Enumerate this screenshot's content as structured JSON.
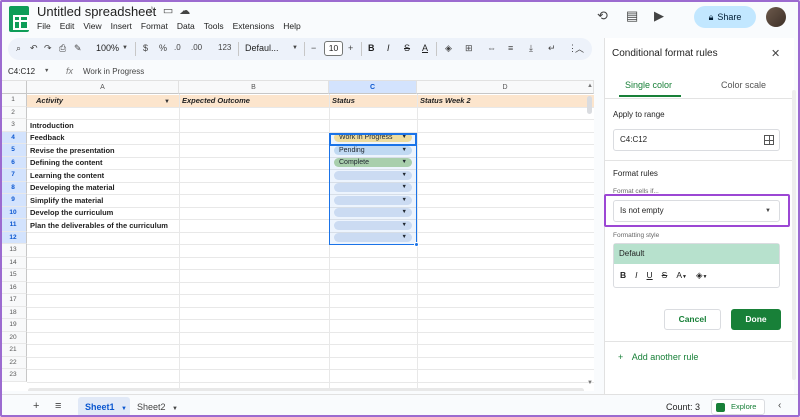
{
  "app": {
    "doc_title": "Untitled spreadsheet",
    "menu": [
      "File",
      "Edit",
      "View",
      "Insert",
      "Format",
      "Data",
      "Tools",
      "Extensions",
      "Help"
    ],
    "share_label": "Share"
  },
  "toolbar": {
    "zoom": "100%",
    "currency": "$",
    "percent": "%",
    "decrease_decimal": ".0",
    "increase_decimal": ".00",
    "number_format": "123",
    "font": "Defaul...",
    "font_size": "10",
    "bold": "B",
    "italic": "I",
    "strike": "S",
    "text_color": "A"
  },
  "formula_bar": {
    "name_box": "C4:C12",
    "fx": "fx",
    "value": "Work in Progress"
  },
  "grid": {
    "columns": [
      "A",
      "B",
      "C",
      "D"
    ],
    "rows": [
      "1",
      "2",
      "3",
      "4",
      "5",
      "6",
      "7",
      "8",
      "9",
      "10",
      "11",
      "12",
      "13",
      "14",
      "15",
      "16",
      "17",
      "18",
      "19",
      "20",
      "21",
      "22",
      "23"
    ],
    "header_row": {
      "a": "Activity",
      "b": "Expected Outcome",
      "c": "Status",
      "d": "Status Week 2"
    },
    "col_a": {
      "r3": "Introduction",
      "r4": "Feedback",
      "r5": "Revise the presentation",
      "r6": "Defining the content",
      "r7": "Learning the content",
      "r8": "Developing the material",
      "r9": "Simplify the material",
      "r10": "Develop the curriculum",
      "r11": "Plan the deliverables of the curriculum"
    },
    "status_chips": [
      {
        "text": "Work in Progress",
        "color": "#ffe599"
      },
      {
        "text": "Pending",
        "color": "#cfe2f3"
      },
      {
        "text": "Complete",
        "color": "#b6d7a8"
      },
      {
        "text": "",
        "color": "#dbe4f3"
      },
      {
        "text": "",
        "color": "#dbe4f3"
      },
      {
        "text": "",
        "color": "#dbe4f3"
      },
      {
        "text": "",
        "color": "#dbe4f3"
      },
      {
        "text": "",
        "color": "#dbe4f3"
      },
      {
        "text": "",
        "color": "#dbe4f3"
      }
    ]
  },
  "sheets": {
    "active": "Sheet1",
    "other": "Sheet2",
    "count": "Count: 3",
    "explore": "Explore"
  },
  "panel": {
    "title": "Conditional format rules",
    "tab_single": "Single color",
    "tab_scale": "Color scale",
    "apply_label": "Apply to range",
    "range": "C4:C12",
    "rules_label": "Format rules",
    "cells_if_label": "Format cells if...",
    "condition": "Is not empty",
    "style_label": "Formatting style",
    "style_preview": "Default",
    "cancel": "Cancel",
    "done": "Done",
    "add_rule": "Add another rule"
  },
  "colors": {
    "accent_green": "#188038",
    "highlight_purple": "#9c47d4",
    "header_row_bg": "#fce5cd",
    "selection_blue": "#1a73e8"
  }
}
